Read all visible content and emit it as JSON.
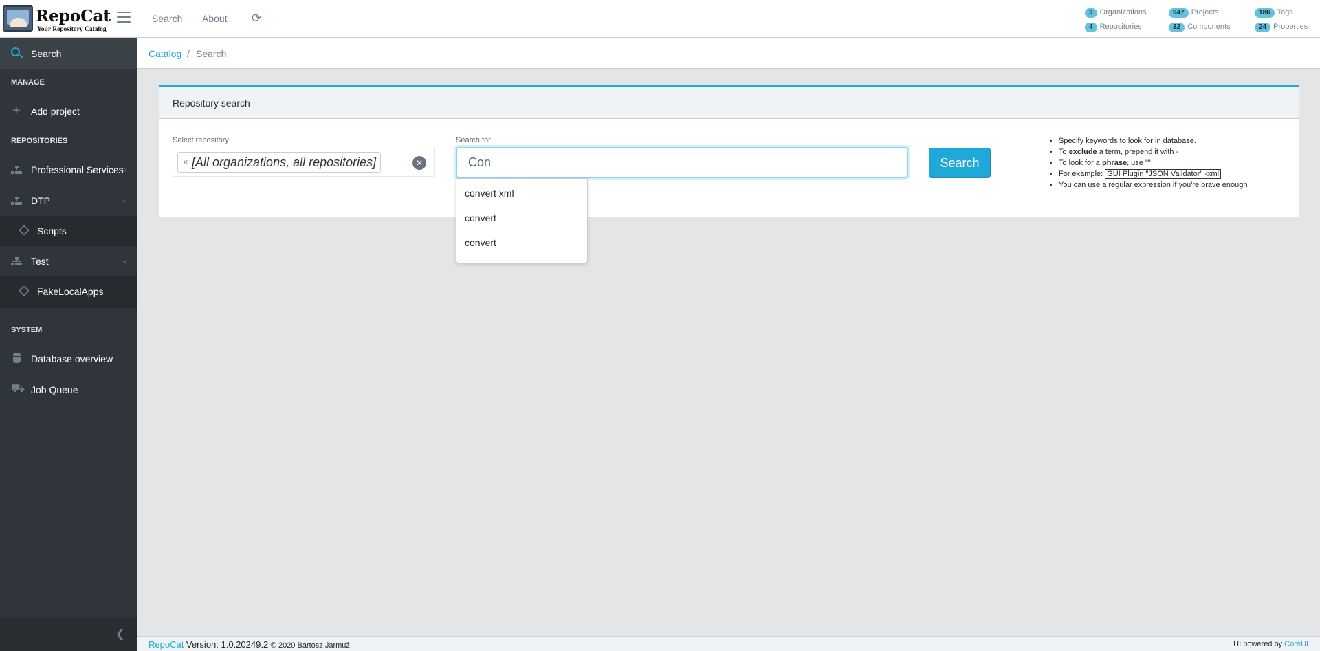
{
  "brand": {
    "title": "RepoCat",
    "subtitle": "Your Repository Catalog"
  },
  "topnav": {
    "search": "Search",
    "about": "About",
    "refresh_icon": "refresh-icon"
  },
  "stats": [
    {
      "count": "3",
      "label": "Organizations"
    },
    {
      "count": "947",
      "label": "Projects"
    },
    {
      "count": "186",
      "label": "Tags"
    },
    {
      "count": "4",
      "label": "Repositories"
    },
    {
      "count": "32",
      "label": "Components"
    },
    {
      "count": "24",
      "label": "Properties"
    }
  ],
  "sidebar": {
    "search": "Search",
    "manage_title": "MANAGE",
    "add_project": "Add project",
    "repositories_title": "REPOSITORIES",
    "repos": [
      {
        "label": "Professional Services",
        "chevron": "‹"
      },
      {
        "label": "DTP",
        "chevron": "⌄"
      },
      {
        "label": "Scripts"
      },
      {
        "label": "Test",
        "chevron": "⌄"
      },
      {
        "label": "FakeLocalApps"
      }
    ],
    "system_title": "SYSTEM",
    "database_overview": "Database overview",
    "job_queue": "Job Queue"
  },
  "breadcrumb": {
    "catalog": "Catalog",
    "separator": "/",
    "current": "Search"
  },
  "card": {
    "title": "Repository search",
    "select_label": "Select repository",
    "selected_tag": "[All organizations, all repositories]",
    "search_label": "Search for",
    "search_value": "Con",
    "search_button": "Search"
  },
  "tips": {
    "t1": "Specify keywords to look for in database.",
    "t2_pre": "To ",
    "t2_bold": "exclude",
    "t2_post": " a term, prepend it with -",
    "t3_pre": "To look for a ",
    "t3_bold": "phrase",
    "t3_post": ", use \"\"",
    "t4_pre": "For example: ",
    "t4_code": "GUI Plugin \"JSON Validator\" -xml",
    "t5": "You can use a regular expression if you're brave enough"
  },
  "suggestions": [
    "convert xml",
    "convert",
    "convert"
  ],
  "footer": {
    "app_link": "RepoCat",
    "version": " Version: 1.0.20249.2 ",
    "copyright": "© 2020 Bartosz Jarmuż.",
    "powered": "UI powered by ",
    "powered_link": "CoreUI"
  },
  "colors": {
    "accent": "#20a8d8",
    "sidebar_bg": "#2f353a",
    "badge": "#63c2de"
  }
}
